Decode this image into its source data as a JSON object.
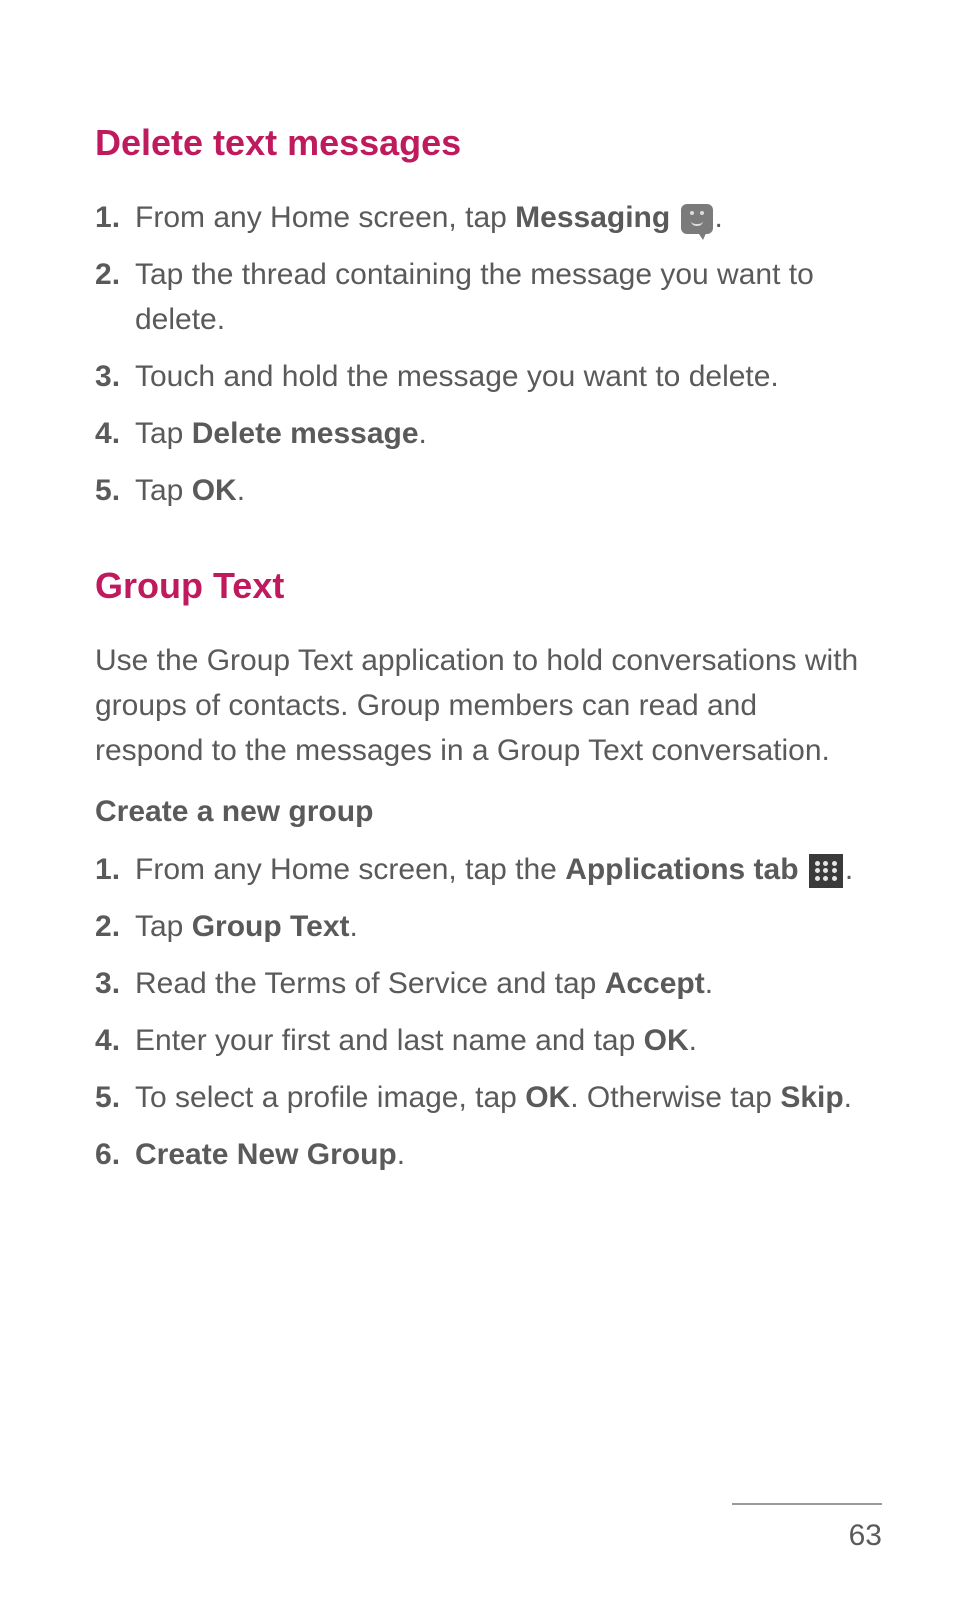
{
  "section1": {
    "heading": "Delete text messages",
    "steps": {
      "s1_pre": "From any Home screen, tap ",
      "s1_bold": "Messaging",
      "s1_post": ".",
      "s2": "Tap the thread containing the message you want to delete.",
      "s3": "Touch and hold the message you want to delete.",
      "s4_pre": "Tap ",
      "s4_bold": "Delete message",
      "s4_post": ".",
      "s5_pre": "Tap ",
      "s5_bold": "OK",
      "s5_post": "."
    }
  },
  "section2": {
    "heading": "Group Text",
    "intro": "Use the Group Text application to hold conversations with groups of contacts. Group members can read and respond to the messages in a Group Text conversation.",
    "subheading": "Create a new group",
    "steps": {
      "s1_pre": "From any Home screen, tap the ",
      "s1_bold": "Applications tab",
      "s1_post": ".",
      "s2_pre": "Tap ",
      "s2_bold": "Group Text",
      "s2_post": ".",
      "s3_pre": "Read the Terms of Service and tap ",
      "s3_bold": "Accept",
      "s3_post": ".",
      "s4_pre": "Enter your first and last name and tap ",
      "s4_bold": "OK",
      "s4_post": ".",
      "s5_pre": "To select a profile image, tap ",
      "s5_bold1": "OK",
      "s5_mid": ". Otherwise tap ",
      "s5_bold2": "Skip",
      "s5_post": ".",
      "s6_bold": "Create New Group",
      "s6_post": "."
    }
  },
  "page_number": "63",
  "colors": {
    "heading": "#bf1a5e",
    "body": "#5a5a5a"
  }
}
